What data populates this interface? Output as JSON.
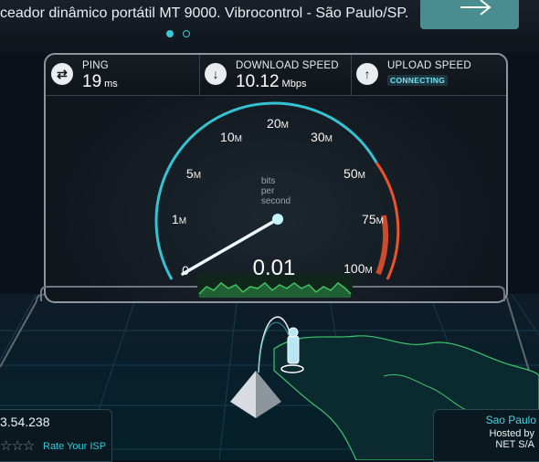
{
  "banner": {
    "text": "ceador dinâmico portátil MT 9000. Vibrocontrol - São Paulo/SP.",
    "carousel_dots": 2,
    "active_dot": 1
  },
  "stats": {
    "ping": {
      "label": "PING",
      "value": "19",
      "unit": "ms",
      "icon": "ping-arrows-icon"
    },
    "download": {
      "label": "DOWNLOAD SPEED",
      "value": "10.12",
      "unit": "Mbps",
      "icon": "download-arrow-icon"
    },
    "upload": {
      "label": "UPLOAD SPEED",
      "status": "CONNECTING",
      "icon": "upload-arrow-icon"
    }
  },
  "gauge": {
    "unit_text": "bits per second",
    "reading": "0.01",
    "scale": [
      {
        "num": "0",
        "suffix": ""
      },
      {
        "num": "1",
        "suffix": "M"
      },
      {
        "num": "5",
        "suffix": "M"
      },
      {
        "num": "10",
        "suffix": "M"
      },
      {
        "num": "20",
        "suffix": "M"
      },
      {
        "num": "30",
        "suffix": "M"
      },
      {
        "num": "50",
        "suffix": "M"
      },
      {
        "num": "75",
        "suffix": "M"
      },
      {
        "num": "100",
        "suffix": "M"
      }
    ],
    "colors": {
      "normal": "#35c3d3",
      "high": "#f0512d",
      "needle": "#e8fbff"
    }
  },
  "isp": {
    "ip": "3.54.238",
    "rate_label": "Rate Your ISP",
    "stars": 5
  },
  "server": {
    "city": "Sao Paulo",
    "hosted_by_label": "Hosted by",
    "host": "NET S/A"
  }
}
